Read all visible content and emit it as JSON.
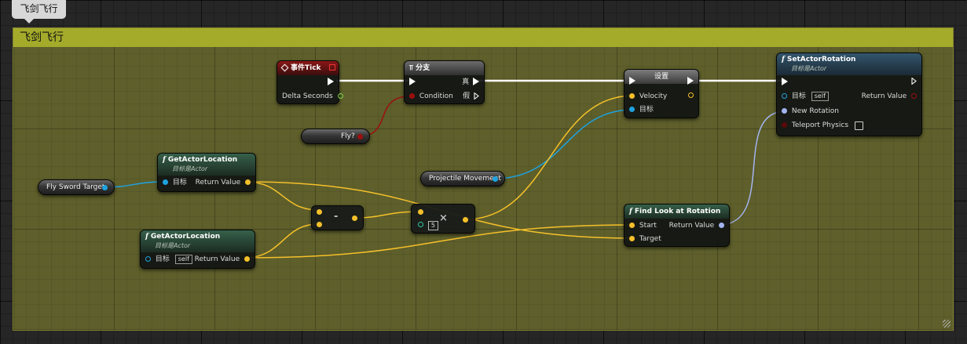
{
  "comment": {
    "tab_label": "飞剑飞行",
    "header_title": "飞剑飞行"
  },
  "colors": {
    "exec": "#ffffff",
    "object": "#1ea2e0",
    "vector": "#f5c02a",
    "rotator": "#a3b4f0",
    "boolean": "#9c0e0e",
    "float": "#7bd84b",
    "int": "#31c5a5",
    "comment_header": "#a4ab2a",
    "comment_body": "#5e5f2b"
  },
  "nodes": {
    "event_tick": {
      "title": "事件Tick",
      "delta_seconds": "Delta Seconds"
    },
    "branch": {
      "title": "分支",
      "condition": "Condition",
      "true_label": "真",
      "false_label": "假"
    },
    "fly_var": {
      "label": "Fly?"
    },
    "set_node": {
      "title": "设置",
      "velocity": "Velocity",
      "target": "目标"
    },
    "projectile_movement": {
      "label": "Projectile Movement"
    },
    "set_actor_rotation": {
      "title": "SetActorRotation",
      "subtitle": "目标是Actor",
      "target": "目标",
      "self": "self",
      "return_value": "Return Value",
      "new_rotation": "New Rotation",
      "teleport_physics": "Teleport Physics"
    },
    "fly_sword_target": {
      "label": "Fly Sword Target"
    },
    "get_actor_location_1": {
      "title": "GetActorLocation",
      "subtitle": "目标是Actor",
      "target": "目标",
      "return_value": "Return Value"
    },
    "get_actor_location_2": {
      "title": "GetActorLocation",
      "subtitle": "目标是Actor",
      "target": "目标",
      "self": "self",
      "return_value": "Return Value"
    },
    "subtract": {
      "symbol": "-"
    },
    "multiply": {
      "symbol": "×",
      "constant": "5"
    },
    "find_look_at": {
      "title": "Find Look at Rotation",
      "start": "Start",
      "target": "Target",
      "return_value": "Return Value"
    }
  }
}
